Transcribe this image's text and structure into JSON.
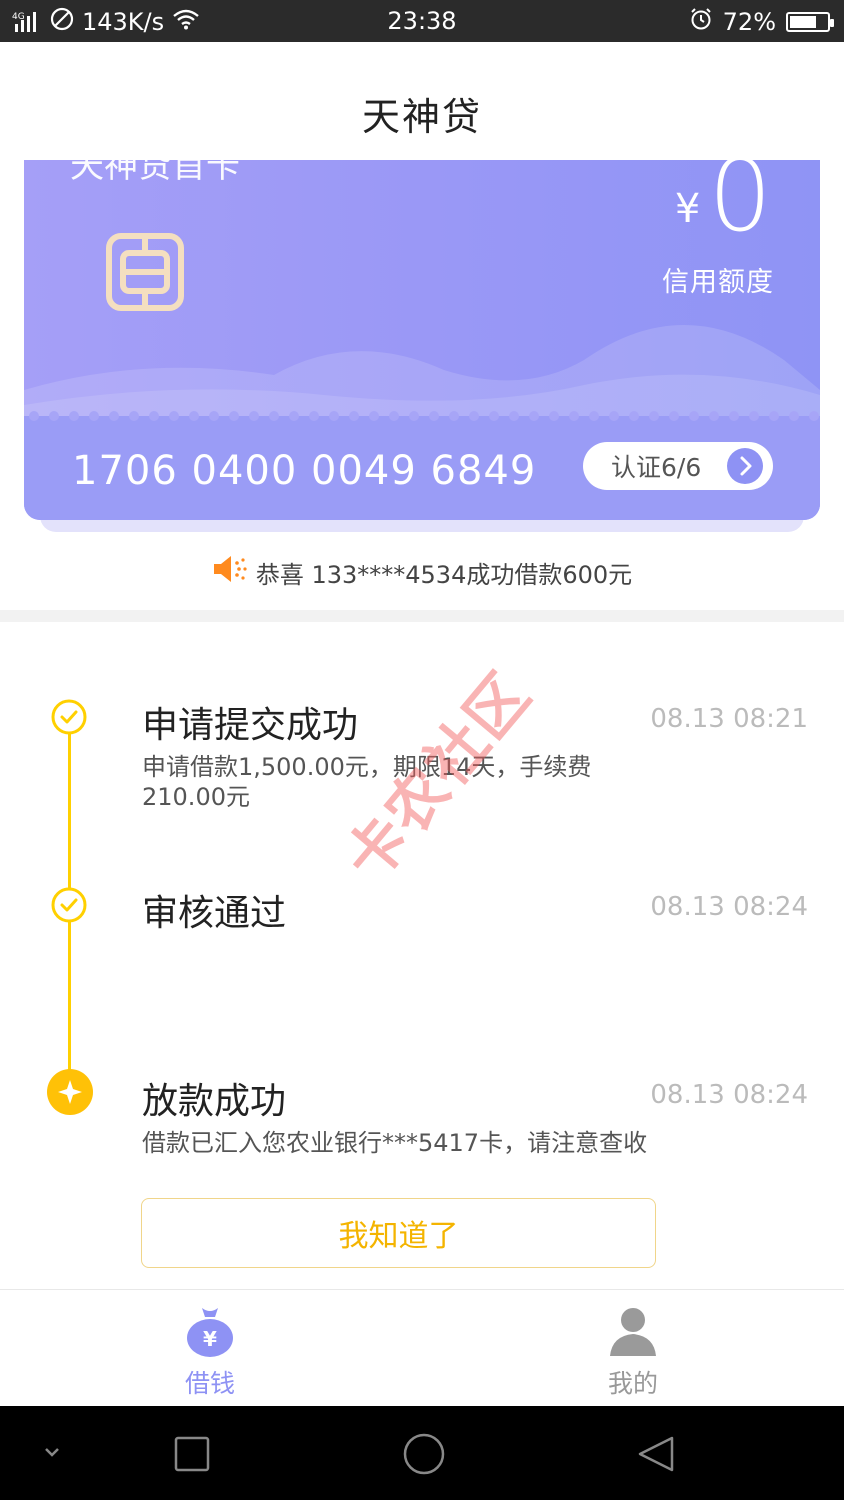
{
  "status_bar": {
    "network": "4G",
    "speed": "143K/s",
    "time": "23:38",
    "battery": "72%",
    "battery_level": 0.72
  },
  "header": {
    "title": "天神贷"
  },
  "card": {
    "name": "天神贷首卡",
    "currency_symbol": "¥",
    "credit_amount": "0",
    "credit_label": "信用额度",
    "card_number": "1706 0400 0049 6849",
    "verify_label": "认证6/6"
  },
  "notice": {
    "text": "恭喜 133****4534成功借款600元"
  },
  "timeline": [
    {
      "title": "申请提交成功",
      "time": "08.13 08:21",
      "desc_line1": "申请借款1,500.00元，期限14天，手续费",
      "desc_line2": "210.00元"
    },
    {
      "title": "审核通过",
      "time": "08.13 08:24",
      "desc_line1": "",
      "desc_line2": ""
    },
    {
      "title": "放款成功",
      "time": "08.13 08:24",
      "desc_line1": "借款已汇入您农业银行***5417卡，请注意查收",
      "desc_line2": ""
    }
  ],
  "ack_button": "我知道了",
  "watermark": "卡农社区",
  "tabs": [
    {
      "label": "借钱",
      "icon": "money-bag-icon",
      "active": true
    },
    {
      "label": "我的",
      "icon": "user-icon",
      "active": false
    }
  ],
  "colors": {
    "accent": "#8e92f4",
    "timeline": "#ffd000",
    "button_text": "#f4b400",
    "tab_active": "#8e92f4",
    "tab_inactive": "#999999"
  }
}
